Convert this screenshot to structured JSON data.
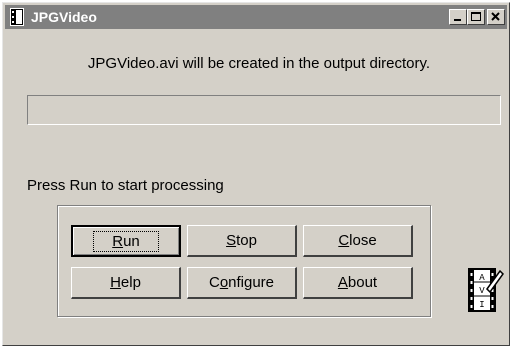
{
  "window": {
    "title": "JPGVideo",
    "controls": {
      "minimize": "minimize",
      "maximize": "maximize",
      "close": "close"
    }
  },
  "message": "JPGVideo.avi will be created  in the output directory.",
  "progress": {
    "value": 0
  },
  "status": "Press Run to start processing",
  "buttons": {
    "run": {
      "label": "Run",
      "mnemonic": "R"
    },
    "stop": {
      "label": "Stop",
      "mnemonic": "S"
    },
    "close": {
      "label": "Close",
      "mnemonic": "C"
    },
    "help": {
      "label": "Help",
      "mnemonic": "H"
    },
    "configure": {
      "label": "Configure",
      "mnemonic": "o"
    },
    "about": {
      "label": "About",
      "mnemonic": "A"
    }
  },
  "icons": {
    "app": "film-clapper-icon",
    "avi": "avi-film-icon",
    "avi_letters": [
      "A",
      "V",
      "I"
    ]
  },
  "colors": {
    "titlebar": "#808080",
    "face": "#d4d0c8"
  }
}
